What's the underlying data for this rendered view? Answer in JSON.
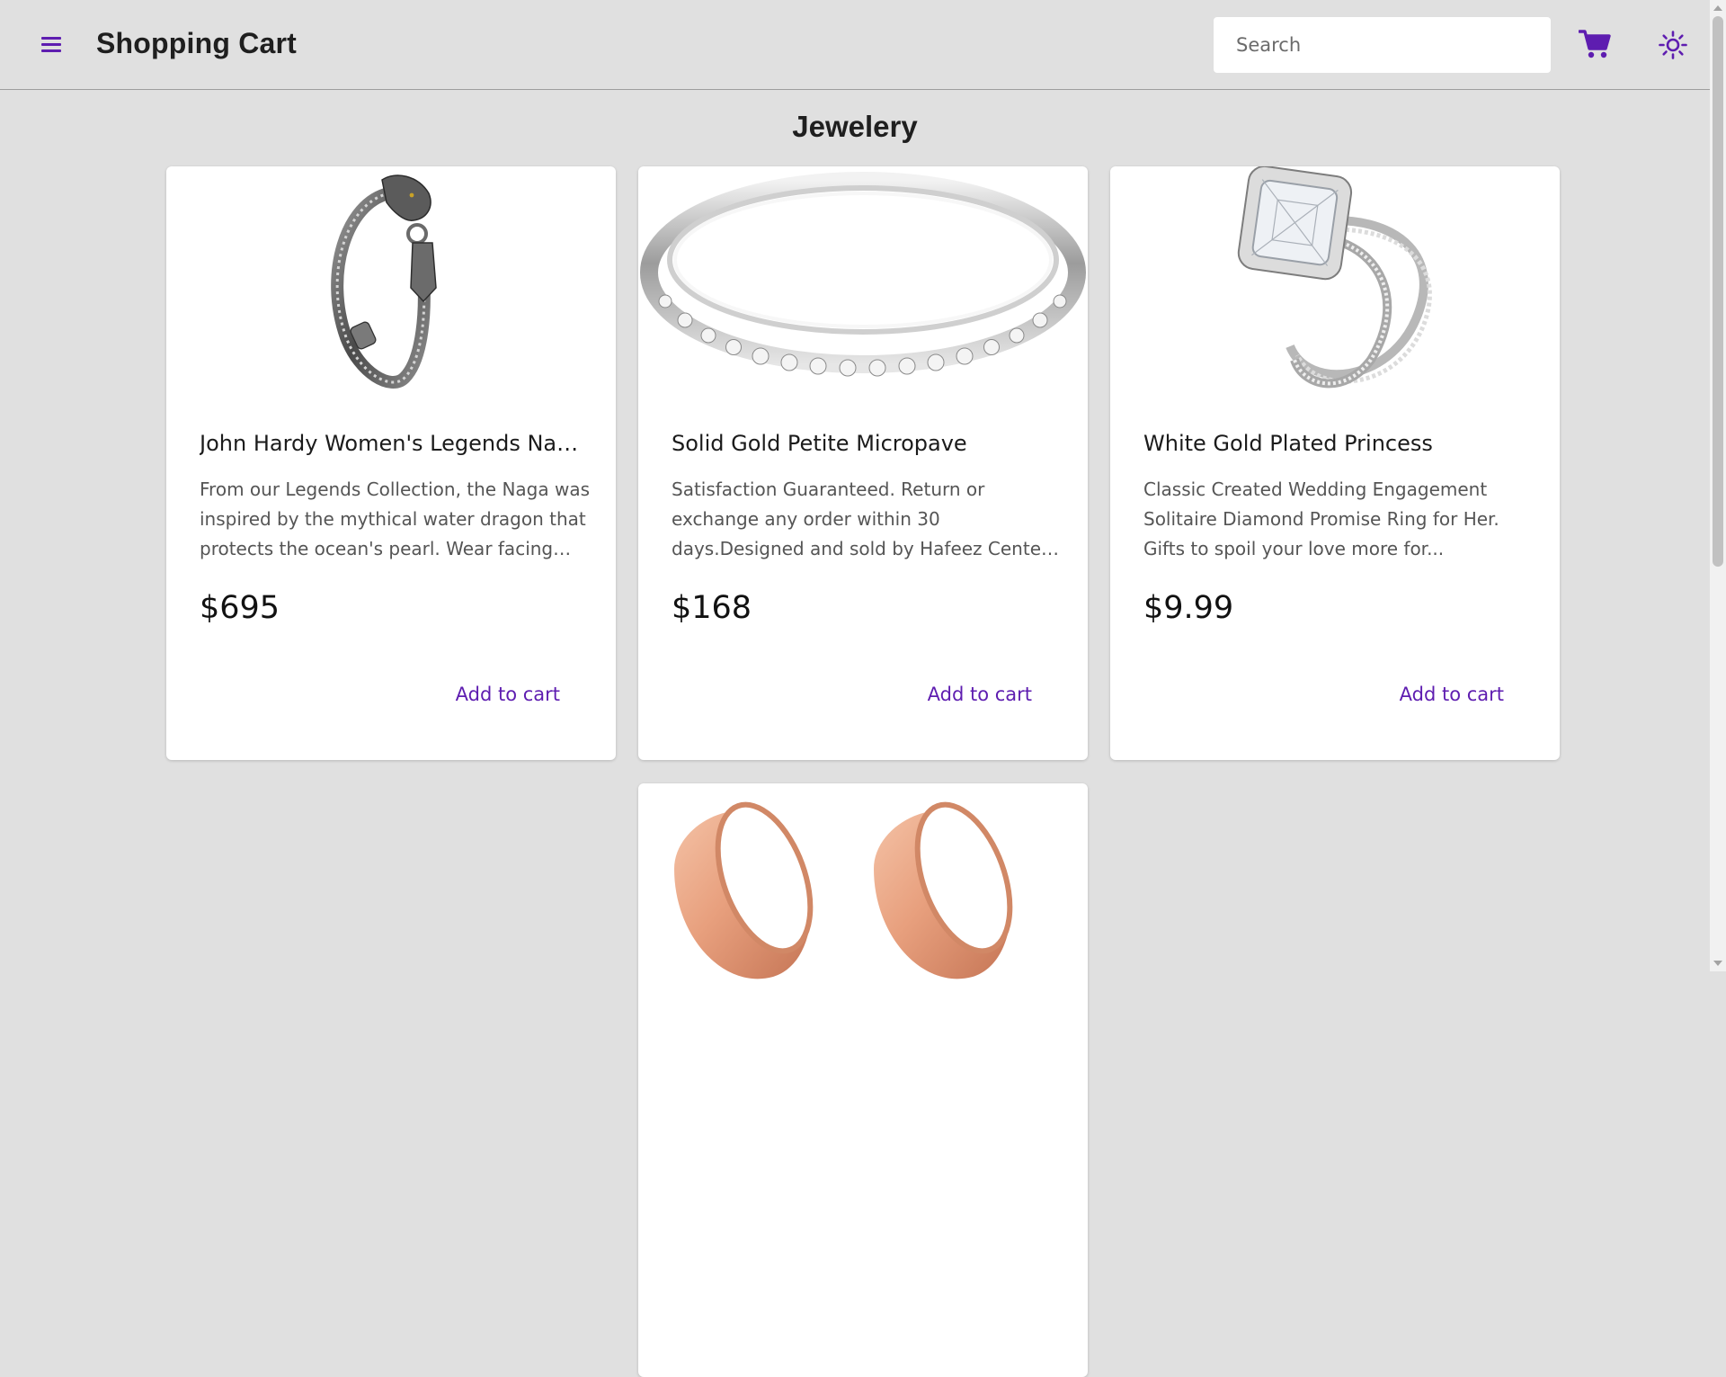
{
  "appbar": {
    "title": "Shopping Cart",
    "search_placeholder": "Search",
    "accent_color": "#5e1db0"
  },
  "page": {
    "section_title": "Jewelery"
  },
  "products": [
    {
      "title": "John Hardy Women's Legends Naga Gold & Silver Dragon Station Chain Bracelet",
      "description": "From our Legends Collection, the Naga was inspired by the mythical water dragon that protects the ocean's pearl. Wear facing inward to be bestowed with love and abundance, or outward for protection.",
      "price": "$695",
      "action": "Add to cart",
      "image": "bracelet"
    },
    {
      "title": "Solid Gold Petite Micropave",
      "description": "Satisfaction Guaranteed. Return or exchange any order within 30 days.Designed and sold by Hafeez Center in the United States.",
      "price": "$168",
      "action": "Add to cart",
      "image": "eternity-ring"
    },
    {
      "title": "White Gold Plated Princess",
      "description": "Classic Created Wedding Engagement Solitaire Diamond Promise Ring for Her. Gifts to spoil your love more for...",
      "price": "$9.99",
      "action": "Add to cart",
      "image": "princess-ring-set"
    },
    {
      "image": "rose-gold-tunnel-plugs"
    }
  ],
  "icons": {
    "menu": "hamburger-menu-icon",
    "cart": "shopping-cart-icon",
    "theme": "sun-icon"
  }
}
